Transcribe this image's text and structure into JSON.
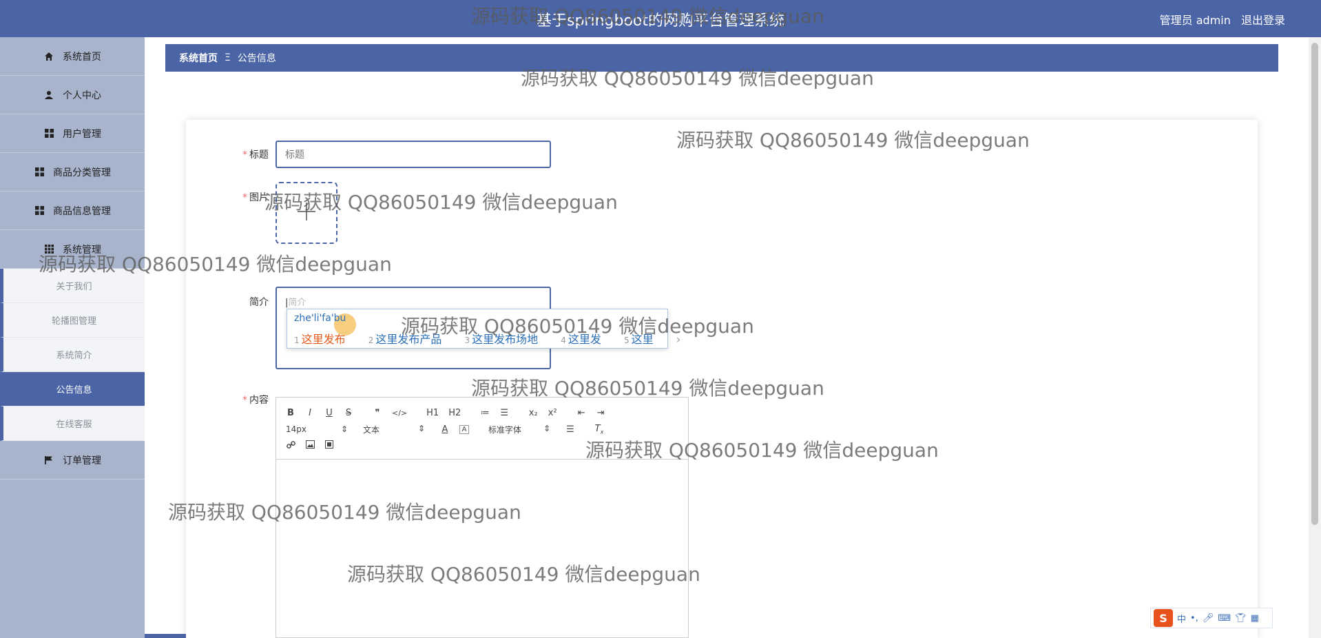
{
  "header": {
    "title": "基于springboot的网购平台管理系统",
    "user_label": "管理员 admin",
    "logout_label": "退出登录"
  },
  "sidebar": {
    "items": [
      {
        "label": "系统首页",
        "icon": "home-icon"
      },
      {
        "label": "个人中心",
        "icon": "user-icon"
      },
      {
        "label": "用户管理",
        "icon": "grid-icon"
      },
      {
        "label": "商品分类管理",
        "icon": "grid-icon"
      },
      {
        "label": "商品信息管理",
        "icon": "grid-icon"
      },
      {
        "label": "系统管理",
        "icon": "apps-icon"
      }
    ],
    "subitems": [
      {
        "label": "关于我们"
      },
      {
        "label": "轮播图管理"
      },
      {
        "label": "系统简介"
      },
      {
        "label": "公告信息",
        "active": true
      },
      {
        "label": "在线客服"
      }
    ],
    "last_item": {
      "label": "订单管理",
      "icon": "flag-icon"
    }
  },
  "breadcrumb": {
    "home": "系统首页",
    "separator": "Ξ",
    "current": "公告信息"
  },
  "form": {
    "title_label": "标题",
    "title_placeholder": "标题",
    "image_label": "图片",
    "intro_label": "简介",
    "intro_placeholder": "简介",
    "content_label": "内容"
  },
  "ime": {
    "pinyin": "zhe'li'fa'bu",
    "candidates": [
      {
        "num": "1",
        "text": "这里发布"
      },
      {
        "num": "2",
        "text": "这里发布产品"
      },
      {
        "num": "3",
        "text": "这里发布场地"
      },
      {
        "num": "4",
        "text": "这里发"
      },
      {
        "num": "5",
        "text": "这里"
      }
    ],
    "more": "›"
  },
  "editor": {
    "font_size": "14px",
    "block_type": "文本",
    "font_family": "标准字体",
    "buttons_row1": [
      "B",
      "I",
      "U",
      "S",
      "❞",
      "</>",
      "H1",
      "H2",
      "≔",
      "☰",
      "x₂",
      "x²",
      "⇤",
      "⇥"
    ]
  },
  "watermark": "源码获取 QQ86050149 微信deepguan",
  "ime_bar": {
    "logo": "S",
    "mode": "中",
    "punct": "•,"
  },
  "colors": {
    "primary": "#4a64a5",
    "sidebar_bg": "#a8b4cc",
    "required": "#f56c6c"
  }
}
